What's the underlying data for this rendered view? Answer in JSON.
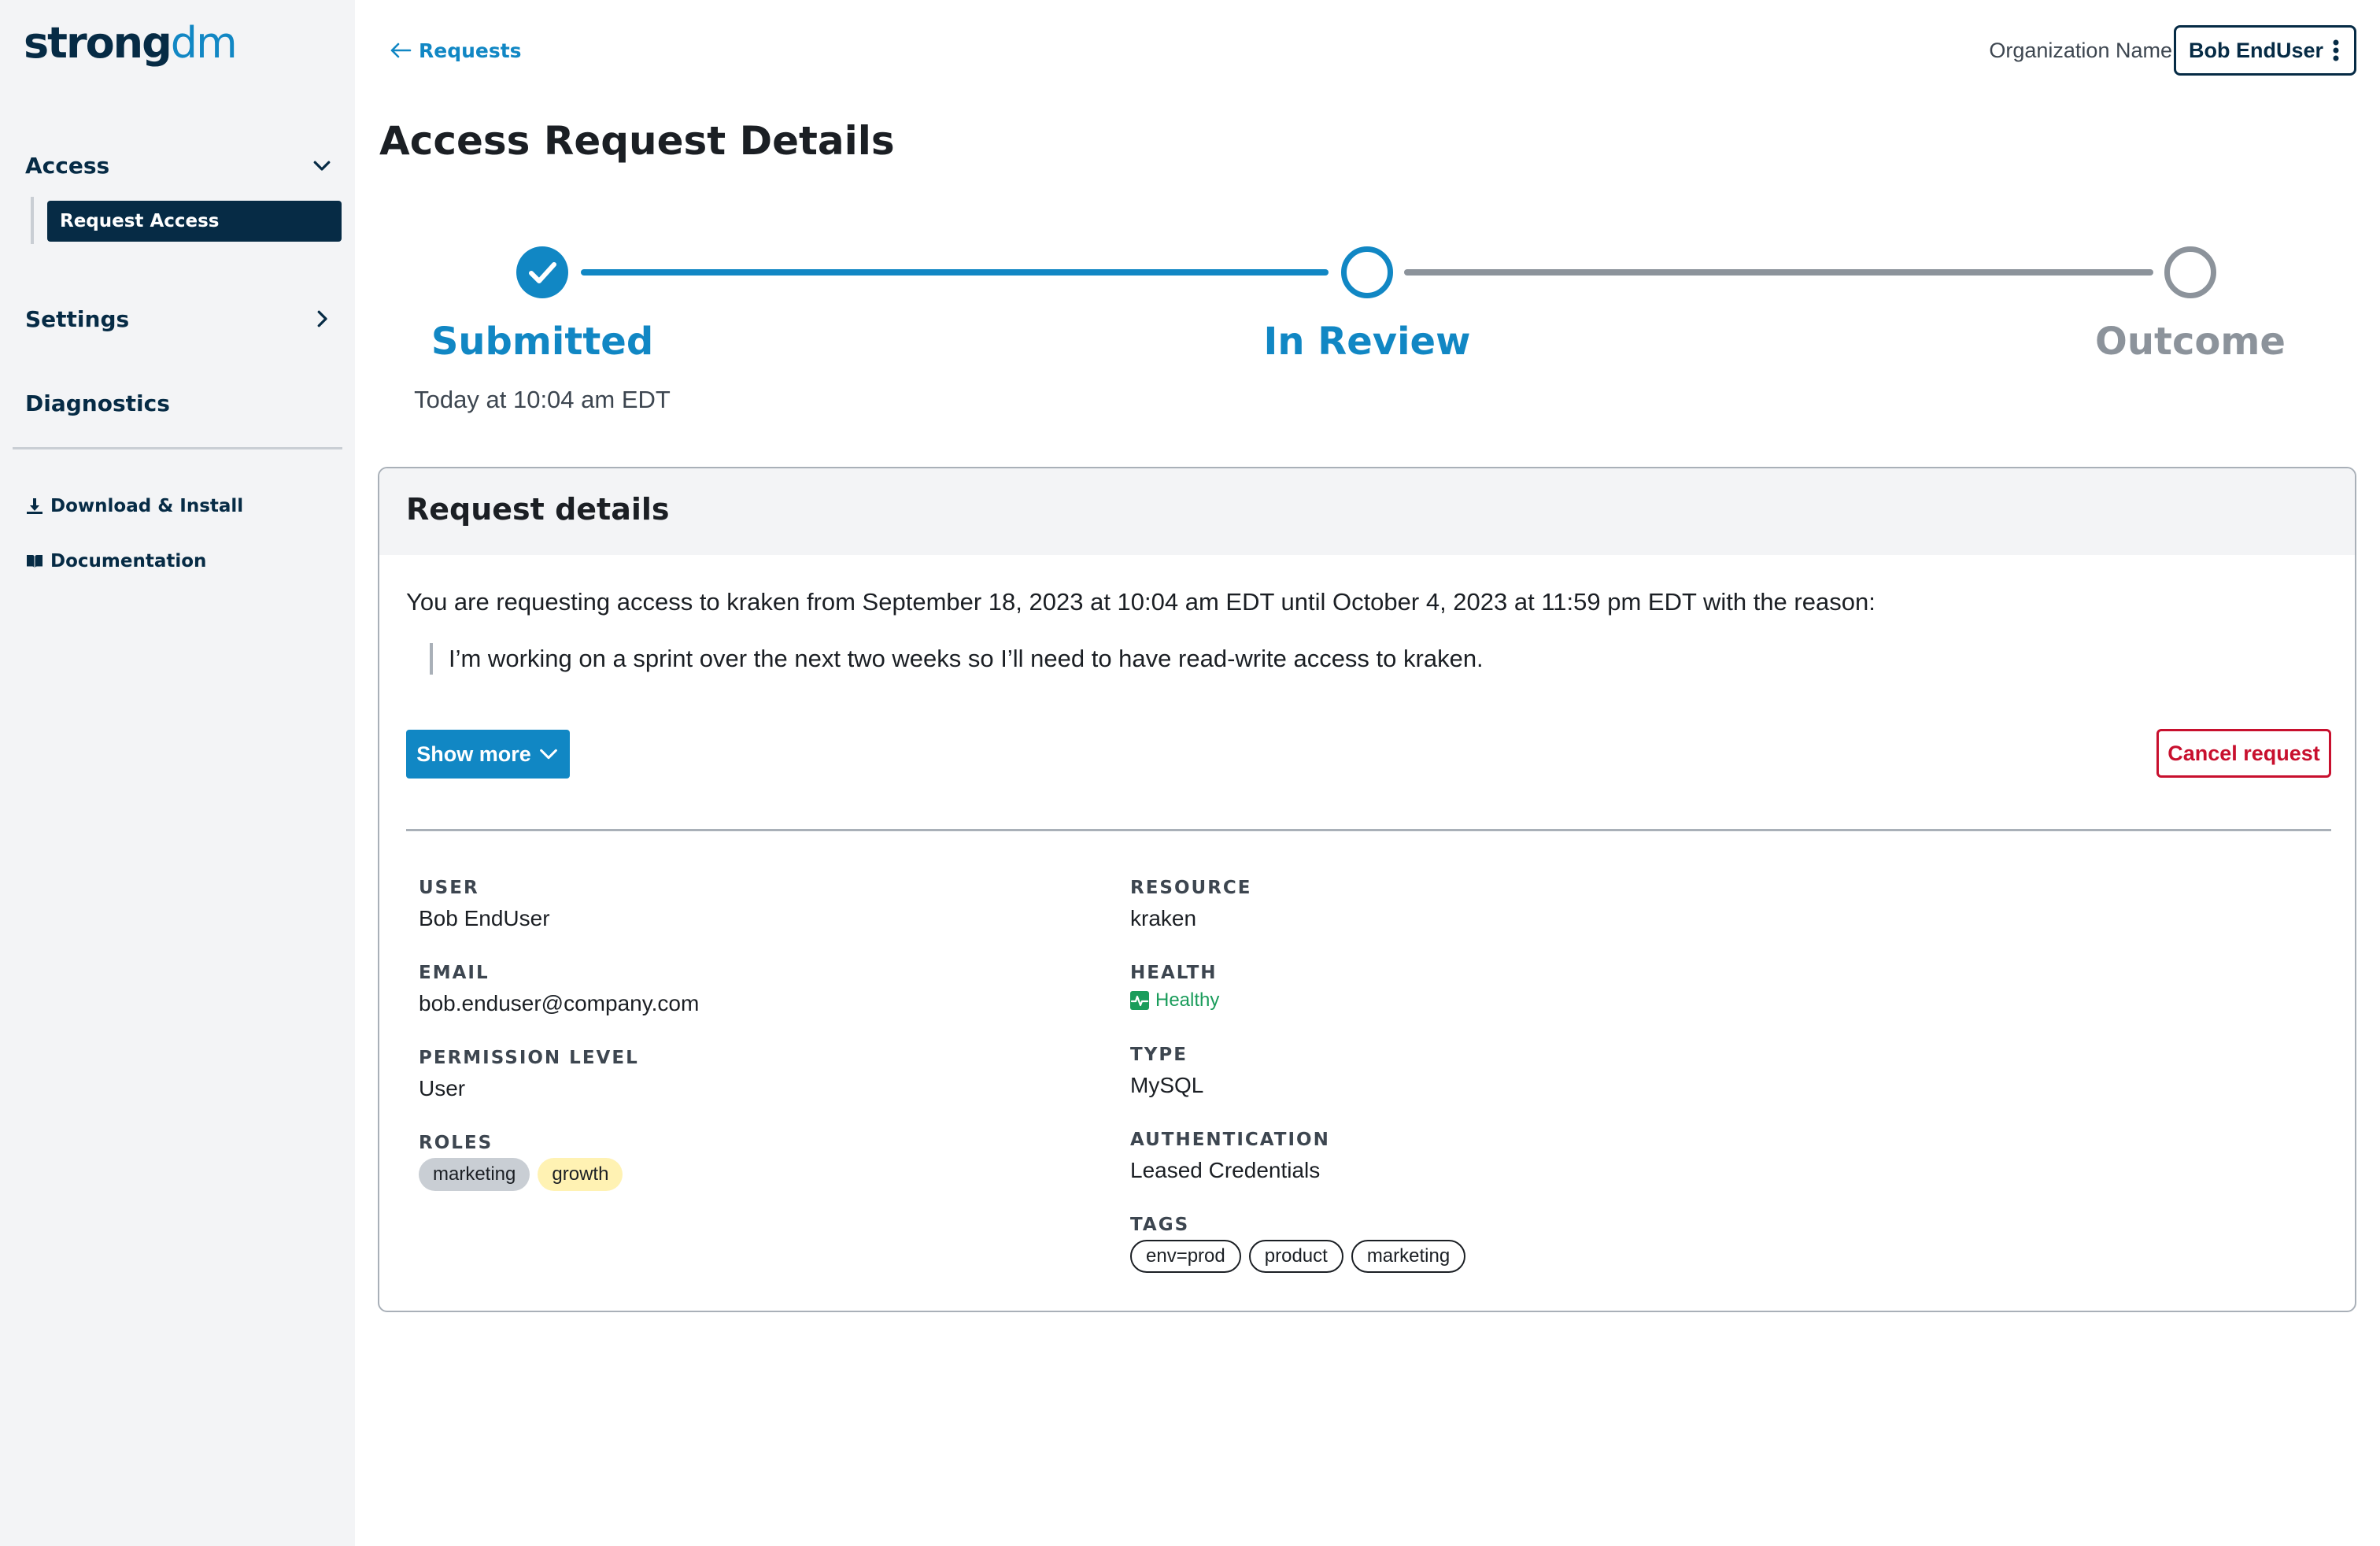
{
  "brand": {
    "logo_strong": "strong",
    "logo_dm": "dm"
  },
  "sidebar": {
    "access_label": "Access",
    "request_access_label": "Request Access",
    "settings_label": "Settings",
    "diagnostics_label": "Diagnostics",
    "download_label": "Download & Install",
    "documentation_label": "Documentation"
  },
  "header": {
    "back_label": "Requests",
    "org_name": "Organization Name",
    "user_name": "Bob EndUser"
  },
  "page": {
    "title": "Access Request Details"
  },
  "stepper": {
    "steps": [
      {
        "label": "Submitted",
        "sub": "Today at 10:04 am EDT",
        "state": "complete"
      },
      {
        "label": "In Review",
        "sub": "",
        "state": "current"
      },
      {
        "label": "Outcome",
        "sub": "",
        "state": "pending"
      }
    ]
  },
  "card": {
    "title": "Request details",
    "request_text": "You are requesting access to kraken from September 18, 2023 at 10:04 am EDT until October 4, 2023 at 11:59 pm EDT with the reason:",
    "reason": "I’m working on a sprint over the next two weeks so I’ll need to have read-write access to kraken.",
    "show_more_label": "Show more",
    "cancel_label": "Cancel request"
  },
  "details": {
    "user_label": "USER",
    "user_value": "Bob EndUser",
    "email_label": "EMAIL",
    "email_value": "bob.enduser@company.com",
    "permission_label": "PERMISSION LEVEL",
    "permission_value": "User",
    "roles_label": "ROLES",
    "roles": [
      "marketing",
      "growth"
    ],
    "resource_label": "RESOURCE",
    "resource_value": "kraken",
    "health_label": "HEALTH",
    "health_value": "Healthy",
    "type_label": "TYPE",
    "type_value": "MySQL",
    "auth_label": "AUTHENTICATION",
    "auth_value": "Leased Credentials",
    "tags_label": "TAGS",
    "tags": [
      "env=prod",
      "product",
      "marketing"
    ]
  },
  "colors": {
    "brand_navy": "#062b45",
    "accent_blue": "#1187c4",
    "danger_red": "#c8102e",
    "healthy_green": "#1a9c5b",
    "pending_gray": "#8c939b"
  }
}
